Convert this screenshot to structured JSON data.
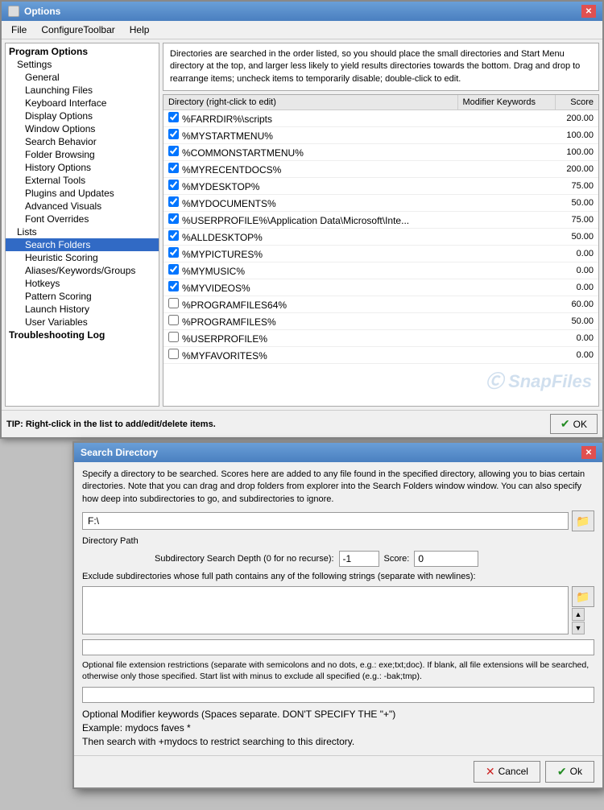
{
  "options_dialog": {
    "title": "Options",
    "menu": [
      "File",
      "ConfigureToolbar",
      "Help"
    ],
    "tree": [
      {
        "label": "Program Options",
        "level": 0
      },
      {
        "label": "Settings",
        "level": 1
      },
      {
        "label": "General",
        "level": 2
      },
      {
        "label": "Launching Files",
        "level": 2
      },
      {
        "label": "Keyboard Interface",
        "level": 2
      },
      {
        "label": "Display Options",
        "level": 2
      },
      {
        "label": "Window Options",
        "level": 2
      },
      {
        "label": "Search Behavior",
        "level": 2
      },
      {
        "label": "Folder Browsing",
        "level": 2
      },
      {
        "label": "History Options",
        "level": 2
      },
      {
        "label": "External Tools",
        "level": 2
      },
      {
        "label": "Plugins and Updates",
        "level": 2
      },
      {
        "label": "Advanced Visuals",
        "level": 2
      },
      {
        "label": "Font Overrides",
        "level": 2
      },
      {
        "label": "Lists",
        "level": 1
      },
      {
        "label": "Search Folders",
        "level": 2,
        "selected": true
      },
      {
        "label": "Heuristic Scoring",
        "level": 2
      },
      {
        "label": "Aliases/Keywords/Groups",
        "level": 2
      },
      {
        "label": "Hotkeys",
        "level": 2
      },
      {
        "label": "Pattern Scoring",
        "level": 2
      },
      {
        "label": "Launch History",
        "level": 2
      },
      {
        "label": "User Variables",
        "level": 2
      },
      {
        "label": "Troubleshooting Log",
        "level": 0
      }
    ],
    "info_text": "Directories are searched in the order listed, so you should place the small directories and Start Menu directory at the top, and larger less likely to yield results directories towards the bottom. Drag and drop to rearrange items; uncheck items to temporarily disable; double-click to edit.",
    "columns": [
      "Directory (right-click to edit)",
      "Modifier Keywords",
      "Score"
    ],
    "directories": [
      {
        "checked": true,
        "path": "%FARRDIR%\\scripts",
        "modifier": "",
        "score": "200.00"
      },
      {
        "checked": true,
        "path": "%MYSTARTMENU%",
        "modifier": "",
        "score": "100.00"
      },
      {
        "checked": true,
        "path": "%COMMONSTARTMENU%",
        "modifier": "",
        "score": "100.00"
      },
      {
        "checked": true,
        "path": "%MYRECENTDOCS%",
        "modifier": "",
        "score": "200.00"
      },
      {
        "checked": true,
        "path": "%MYDESKTOP%",
        "modifier": "",
        "score": "75.00"
      },
      {
        "checked": true,
        "path": "%MYDOCUMENTS%",
        "modifier": "",
        "score": "50.00"
      },
      {
        "checked": true,
        "path": "%USERPROFILE%\\Application Data\\Microsoft\\Inte...",
        "modifier": "",
        "score": "75.00"
      },
      {
        "checked": true,
        "path": "%ALLDESKTOP%",
        "modifier": "",
        "score": "50.00"
      },
      {
        "checked": true,
        "path": "%MYPICTURES%",
        "modifier": "",
        "score": "0.00"
      },
      {
        "checked": true,
        "path": "%MYMUSIC%",
        "modifier": "",
        "score": "0.00"
      },
      {
        "checked": true,
        "path": "%MYVIDEOS%",
        "modifier": "",
        "score": "0.00"
      },
      {
        "checked": false,
        "path": "%PROGRAMFILES64%",
        "modifier": "",
        "score": "60.00"
      },
      {
        "checked": false,
        "path": "%PROGRAMFILES%",
        "modifier": "",
        "score": "50.00"
      },
      {
        "checked": false,
        "path": "%USERPROFILE%",
        "modifier": "",
        "score": "0.00"
      },
      {
        "checked": false,
        "path": "%MYFAVORITES%",
        "modifier": "",
        "score": "0.00"
      }
    ],
    "tip_text": "TIP: Right-click in the list to add/edit/delete items.",
    "ok_label": "OK"
  },
  "search_dialog": {
    "title": "Search Directory",
    "desc_text": "Specify a directory to be searched. Scores here are added to any file found in the specified directory, allowing you to bias certain directories. Note that you can drag and drop folders from explorer into the Search Folders window window. You can also specify how deep into subdirectories to go, and subdirectories to ignore.",
    "path_value": "F:\\",
    "path_label": "Directory Path",
    "subdir_label": "Subdirectory Search Depth (0 for no recurse):",
    "subdir_value": "-1",
    "score_label": "Score:",
    "score_value": "0",
    "exclude_label": "Exclude subdirectories whose full path contains any of the following strings (separate with newlines):",
    "exclude_value": "",
    "ext_label": "Optional file extension restrictions (separate with semicolons and no dots, e.g.: exe;txt;doc). If blank, all file extensions will be searched, otherwise only those specified. Start list with minus to exclude all specified (e.g.: -bak;tmp).",
    "ext_value": "",
    "modifier_label": "Optional Modifier keywords (Spaces separate. DON'T SPECIFY THE \"+\")",
    "modifier_example": "Example: mydocs faves *",
    "modifier_hint": "Then search with +mydocs to restrict searching to this directory.",
    "modifier_value": "",
    "cancel_label": "Cancel",
    "ok_label": "Ok"
  }
}
